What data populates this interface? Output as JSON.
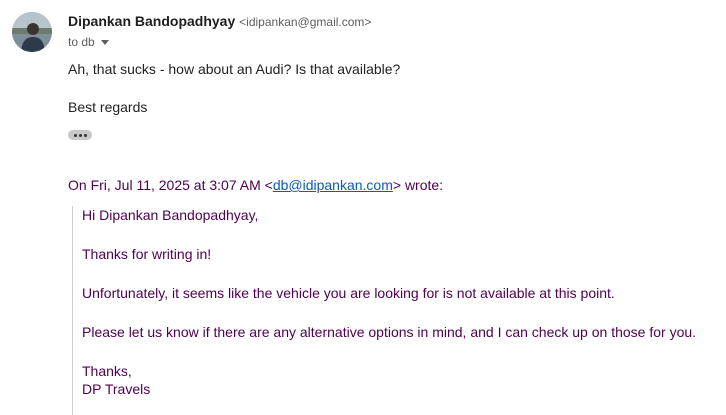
{
  "sender": {
    "name": "Dipankan Bandopadhyay",
    "email": "<idipankan@gmail.com>",
    "to": "to db"
  },
  "body": {
    "line1": "Ah, that sucks - how about an Audi? Is that available?",
    "signoff": "Best regards"
  },
  "quote": {
    "header_prefix": "On Fri, Jul 11, 2025 at 3:07 AM <",
    "header_email": "db@idipankan.com",
    "header_suffix": "> wrote:",
    "greeting": "Hi Dipankan Bandopadhyay,",
    "thanks_line": "Thanks for writing in!",
    "unavailable_line": "Unfortunately, it seems like the vehicle you are looking for is not available at this point.",
    "options_line": "Please let us know if there are any alternative options in mind, and I can check up on those for you.",
    "closing": "Thanks,",
    "signature": "DP Travels"
  }
}
